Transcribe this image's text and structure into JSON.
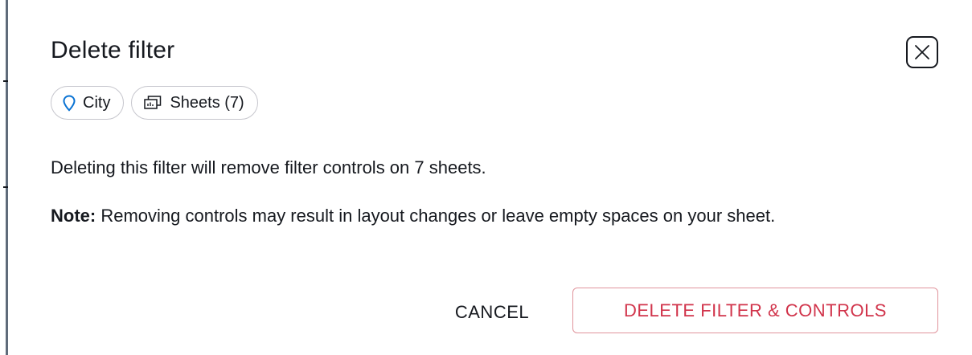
{
  "dialog": {
    "title": "Delete filter",
    "close_icon": "close-icon"
  },
  "chips": [
    {
      "icon": "location-pin-icon",
      "label": "City",
      "icon_color": "#0972d3"
    },
    {
      "icon": "sheets-icon",
      "label": "Sheets (7)"
    }
  ],
  "message": "Deleting this filter will remove filter controls on 7 sheets.",
  "note": {
    "label": "Note:",
    "text": " Removing controls may result in layout changes or leave empty spaces on your sheet."
  },
  "actions": {
    "cancel_label": "CANCEL",
    "delete_label": "DELETE FILTER & CONTROLS"
  },
  "colors": {
    "danger": "#d1344b",
    "danger_border": "#e0949c",
    "text": "#16191f",
    "chip_border": "#c6c6cd"
  }
}
